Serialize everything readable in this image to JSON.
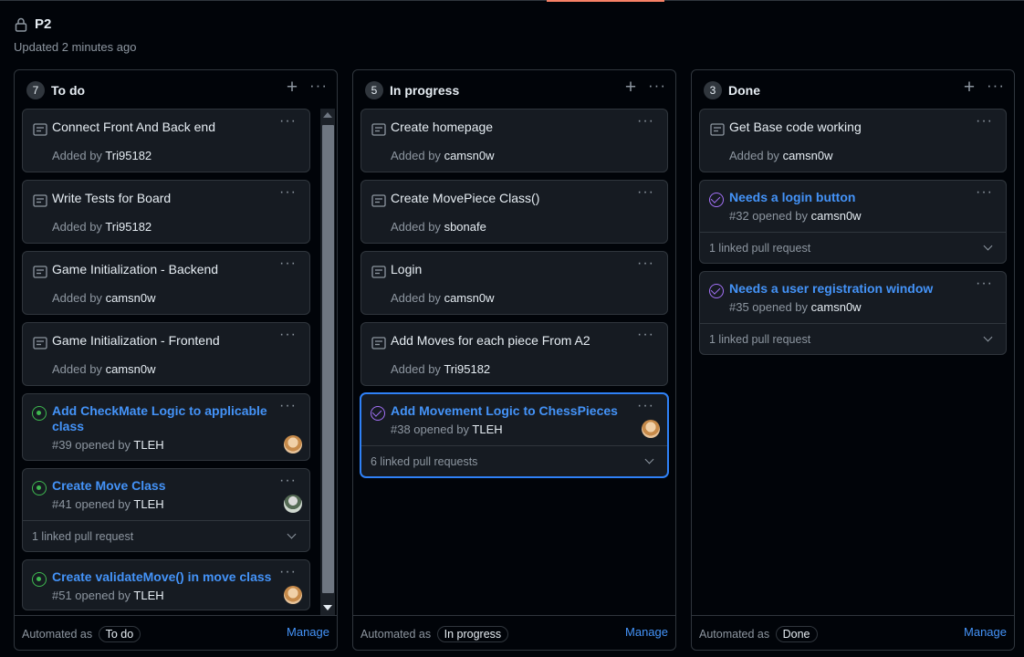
{
  "project": {
    "name": "P2",
    "updated": "Updated 2 minutes ago",
    "lock_icon": "lock-icon"
  },
  "colors": {
    "accent_link": "#4493f8",
    "open_issue": "#3fb950",
    "closed_issue": "#a371f7",
    "selected_border": "#2f81f7"
  },
  "columns": [
    {
      "count": "7",
      "title": "To do",
      "automated_label": "Automated as",
      "automated_value": "To do",
      "manage": "Manage",
      "cards": [
        {
          "title": "Connect Front And Back end",
          "added_prefix": "Added by",
          "user": "Tri95182"
        },
        {
          "title": "Write Tests for Board",
          "added_prefix": "Added by",
          "user": "Tri95182"
        },
        {
          "title": "Game Initialization - Backend",
          "added_prefix": "Added by",
          "user": "camsn0w"
        },
        {
          "title": "Game Initialization - Frontend",
          "added_prefix": "Added by",
          "user": "camsn0w"
        },
        {
          "title": "Add CheckMate Logic to applicable class",
          "meta": "#39 opened by",
          "user": "TLEH"
        },
        {
          "title": "Create Move Class",
          "meta": "#41 opened by",
          "user": "TLEH",
          "linked": "1 linked pull request"
        },
        {
          "title": "Create validateMove() in move class",
          "meta": "#51 opened by",
          "user": "TLEH"
        }
      ]
    },
    {
      "count": "5",
      "title": "In progress",
      "automated_label": "Automated as",
      "automated_value": "In progress",
      "manage": "Manage",
      "cards": [
        {
          "title": "Create homepage",
          "added_prefix": "Added by",
          "user": "camsn0w"
        },
        {
          "title": "Create MovePiece Class()",
          "added_prefix": "Added by",
          "user": "sbonafe"
        },
        {
          "title": "Login",
          "added_prefix": "Added by",
          "user": "camsn0w"
        },
        {
          "title": "Add Moves for each piece From A2",
          "added_prefix": "Added by",
          "user": "Tri95182"
        },
        {
          "title": "Add Movement Logic to ChessPieces",
          "meta": "#38 opened by",
          "user": "TLEH",
          "linked": "6 linked pull requests"
        }
      ]
    },
    {
      "count": "3",
      "title": "Done",
      "automated_label": "Automated as",
      "automated_value": "Done",
      "manage": "Manage",
      "cards": [
        {
          "title": "Get Base code working",
          "added_prefix": "Added by",
          "user": "camsn0w"
        },
        {
          "title": "Needs a login button",
          "meta": "#32 opened by",
          "user": "camsn0w",
          "linked": "1 linked pull request"
        },
        {
          "title": "Needs a user registration window",
          "meta": "#35 opened by",
          "user": "camsn0w",
          "linked": "1 linked pull request"
        }
      ]
    }
  ]
}
